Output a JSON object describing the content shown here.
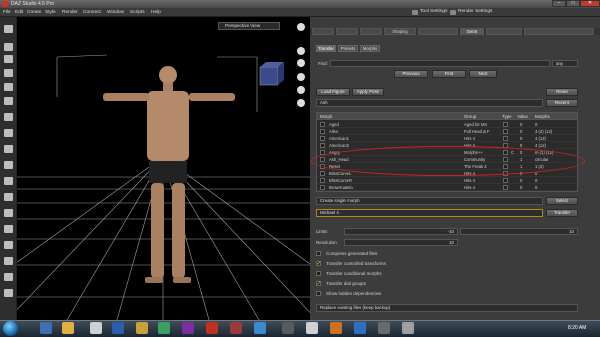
{
  "window": {
    "title": "DAZ Studio 4.5 Pro",
    "min": "–",
    "max": "□",
    "close": "✕"
  },
  "menu": [
    "File",
    "Edit",
    "Create",
    "Style",
    "Render",
    "Connect",
    "Window",
    "Scripts",
    "Help"
  ],
  "toolbar": {
    "tool_settings": "Tool Settings",
    "render_settings": "Render Settings"
  },
  "viewport": {
    "camera": "Perspective View"
  },
  "panel_tabs": [
    "",
    "",
    "",
    "Shaping",
    "",
    "GenX",
    "",
    ""
  ],
  "sub_tabs": [
    "Transfer",
    "Presets",
    "Morphs"
  ],
  "find": {
    "label": "Find:",
    "value": "",
    "any": "any"
  },
  "nav": {
    "previous": "Previous",
    "first": "First",
    "next": "Next"
  },
  "load_figure": "Load Figure",
  "apply_pose": "Apply Pose",
  "reset": "Reset",
  "figure_name": "Ash",
  "recent": "Recent",
  "table": {
    "headers": [
      "Morph",
      "Group",
      "Type",
      "Value",
      "Morphs"
    ],
    "rows": [
      {
        "name": "Aged",
        "group": "Aged for M4",
        "type": "",
        "value": "0",
        "morphs": "0"
      },
      {
        "name": "Allen",
        "group": "Full Head & F",
        "type": "",
        "value": "0",
        "morphs": "3 (4) (12)"
      },
      {
        "name": "American1",
        "group": "Hirs 4",
        "type": "",
        "value": "0",
        "morphs": "4 (12)"
      },
      {
        "name": "American2",
        "group": "Hirs 4",
        "type": "",
        "value": "0",
        "morphs": "4 (12)"
      },
      {
        "name": "Angry",
        "group": "Morphs++",
        "type": "C",
        "value": "0",
        "morphs": "m (1) (12)"
      },
      {
        "name": "Ash_Head",
        "group": "Community",
        "type": "",
        "value": "1",
        "morphs": "circular"
      },
      {
        "name": "Reset",
        "group": "The Freak 4",
        "type": "",
        "value": "1",
        "morphs": "1 (4)"
      },
      {
        "name": "BlissCurveL",
        "group": "Hirs 4",
        "type": "",
        "value": "0",
        "morphs": "0"
      },
      {
        "name": "BlissCurveR",
        "group": "Hirs 4",
        "type": "",
        "value": "0",
        "morphs": "0"
      },
      {
        "name": "BrowAnatelo",
        "group": "Hirs 4",
        "type": "",
        "value": "0",
        "morphs": "0"
      }
    ]
  },
  "create_morph": "Create single morph",
  "select": "Select",
  "target_figure": "Michael 4",
  "transfer": "Transfer",
  "limits": {
    "label": "Limits",
    "value": "-10",
    "value2": "10"
  },
  "resolution": {
    "label": "Resolution",
    "value": "10"
  },
  "options": [
    {
      "label": "Compress generated files",
      "checked": false
    },
    {
      "label": "Transfer controlled transforms",
      "checked": true
    },
    {
      "label": "Transfer conditional morphs",
      "checked": false
    },
    {
      "label": "Transfer dial groups",
      "checked": true
    },
    {
      "label": "Show hidden dependencies",
      "checked": false
    }
  ],
  "replace_dd": "Replace existing files (keep backup)",
  "clock": "8:20 AM"
}
